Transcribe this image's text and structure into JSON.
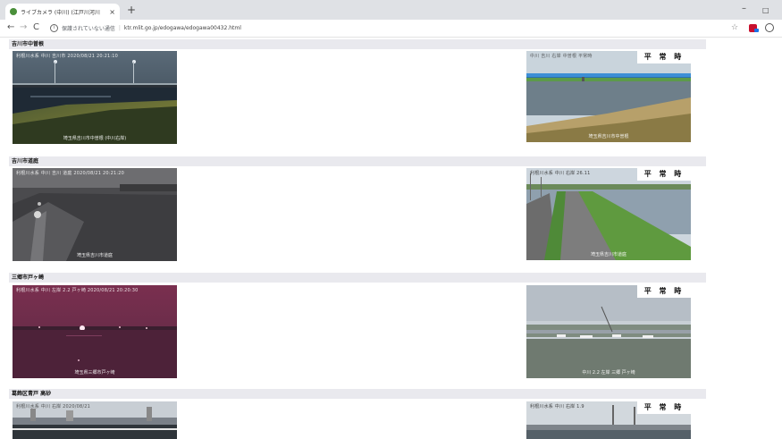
{
  "browser": {
    "tab_title": "ライブカメラ (中川) (江戸川河川",
    "tab_close": "×",
    "new_tab": "+",
    "win_min": "–",
    "win_restore": "□",
    "nav_back": "←",
    "nav_forward": "→",
    "nav_reload": "C",
    "info_icon": "i",
    "security_label": "保護されていない通信",
    "separator": "|",
    "url": "ktr.mlit.go.jp/edogawa/edogawa00432.html",
    "star": "☆"
  },
  "sections": [
    {
      "title": "吉川市中曽根",
      "left_overlay": "利根川水系 中川 吉川市 2020/08/21 20:21:10",
      "left_caption": "埼玉県吉川市中曽根 (中川右岸)",
      "right_overlay": "中川 吉川 右岸 中曽根 平常時",
      "right_caption": "埼玉県吉川市中曽根",
      "right_badge": "平 常 時"
    },
    {
      "title": "吉川市道庭",
      "left_overlay": "利根川水系 中川 吉川 道庭 2020/08/21 20:21:20",
      "left_caption": "埼玉県吉川市道庭",
      "right_overlay": "利根川水系 中川 右岸 26.11",
      "right_caption": "埼玉県吉川市道庭",
      "right_badge": "平 常 時"
    },
    {
      "title": "三郷市戸ヶ崎",
      "left_overlay": "利根川水系 中川 左岸 2.2 戸ヶ崎 2020/08/21 20:20:30",
      "left_caption": "埼玉県三郷市戸ヶ崎",
      "right_overlay": "",
      "right_caption": "中川 2.2 左岸 三郷 戸ヶ崎",
      "right_badge": "平 常 時"
    },
    {
      "title": "葛飾区青戸 高砂",
      "left_overlay": "利根川水系 中川 右岸 2020/08/21",
      "left_caption": "",
      "right_overlay": "利根川水系 中川 右岸 1.9",
      "right_caption": "",
      "right_badge": "平 常 時"
    }
  ],
  "colors": {
    "section_header_bg": "#e9e9ee",
    "tabbar_bg": "#dfe1e5"
  }
}
